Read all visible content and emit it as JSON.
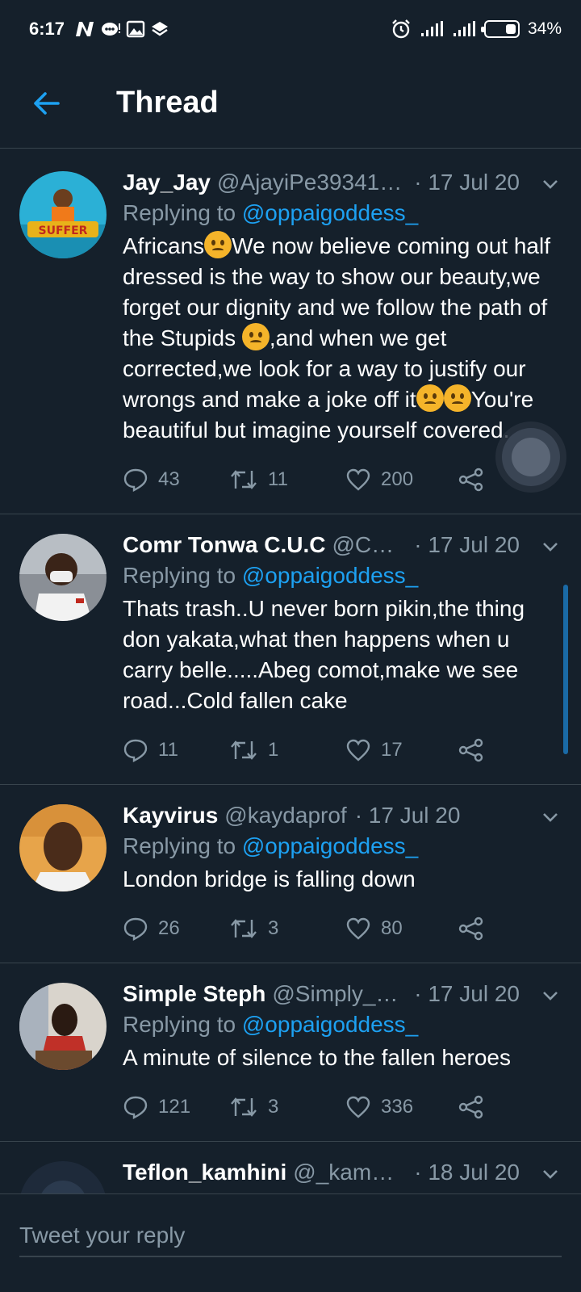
{
  "status_bar": {
    "time": "6:17",
    "battery": "34%",
    "left_icons": [
      "n-logo-icon",
      "chat-icon",
      "image-icon",
      "layers-icon"
    ],
    "right_icons": [
      "alarm-icon",
      "signal-icon",
      "signal-icon-2",
      "battery-icon"
    ]
  },
  "header": {
    "title": "Thread",
    "back_icon": "arrow-left-icon"
  },
  "reply_label": "Replying to",
  "tweets": [
    {
      "name": "Jay_Jay",
      "handle": "@AjayiPe39341…",
      "date": "· 17 Jul 20",
      "mention": "@oppaigoddess_",
      "body": [
        "Africans",
        "We now believe coming out half dressed is the way to show our beauty,we forget our dignity and we follow the path of the Stupids ",
        ",and when we get corrected,we look for a way to justify our wrongs and make a joke off it",
        "You're beautiful but imagine yourself covered."
      ],
      "replies": "43",
      "retweets": "11",
      "likes": "200"
    },
    {
      "name": "Comr Tonwa C.U.C",
      "handle": "@Co…",
      "date": "· 17 Jul 20",
      "mention": "@oppaigoddess_",
      "body": "Thats trash..U never born pikin,the thing don yakata,what then happens when u carry belle.....Abeg comot,make we see road...Cold fallen cake",
      "replies": "11",
      "retweets": "1",
      "likes": "17"
    },
    {
      "name": "Kayvirus",
      "handle": "@kaydaprof",
      "date": "· 17 Jul 20",
      "mention": "@oppaigoddess_",
      "body": "London bridge is falling down",
      "replies": "26",
      "retweets": "3",
      "likes": "80"
    },
    {
      "name": "Simple Steph",
      "handle": "@Simply_…",
      "date": "· 17 Jul 20",
      "mention": "@oppaigoddess_",
      "body": "A minute of silence to the fallen heroes",
      "replies": "121",
      "retweets": "3",
      "likes": "336"
    },
    {
      "name": "Teflon_kamhini",
      "handle": "@_kamh…",
      "date": "· 18 Jul 20"
    }
  ],
  "reply_box": {
    "placeholder": "Tweet your reply"
  },
  "colors": {
    "background": "#15202b",
    "accent": "#1da1f2",
    "muted": "#8899a6",
    "divider": "#38444d"
  }
}
